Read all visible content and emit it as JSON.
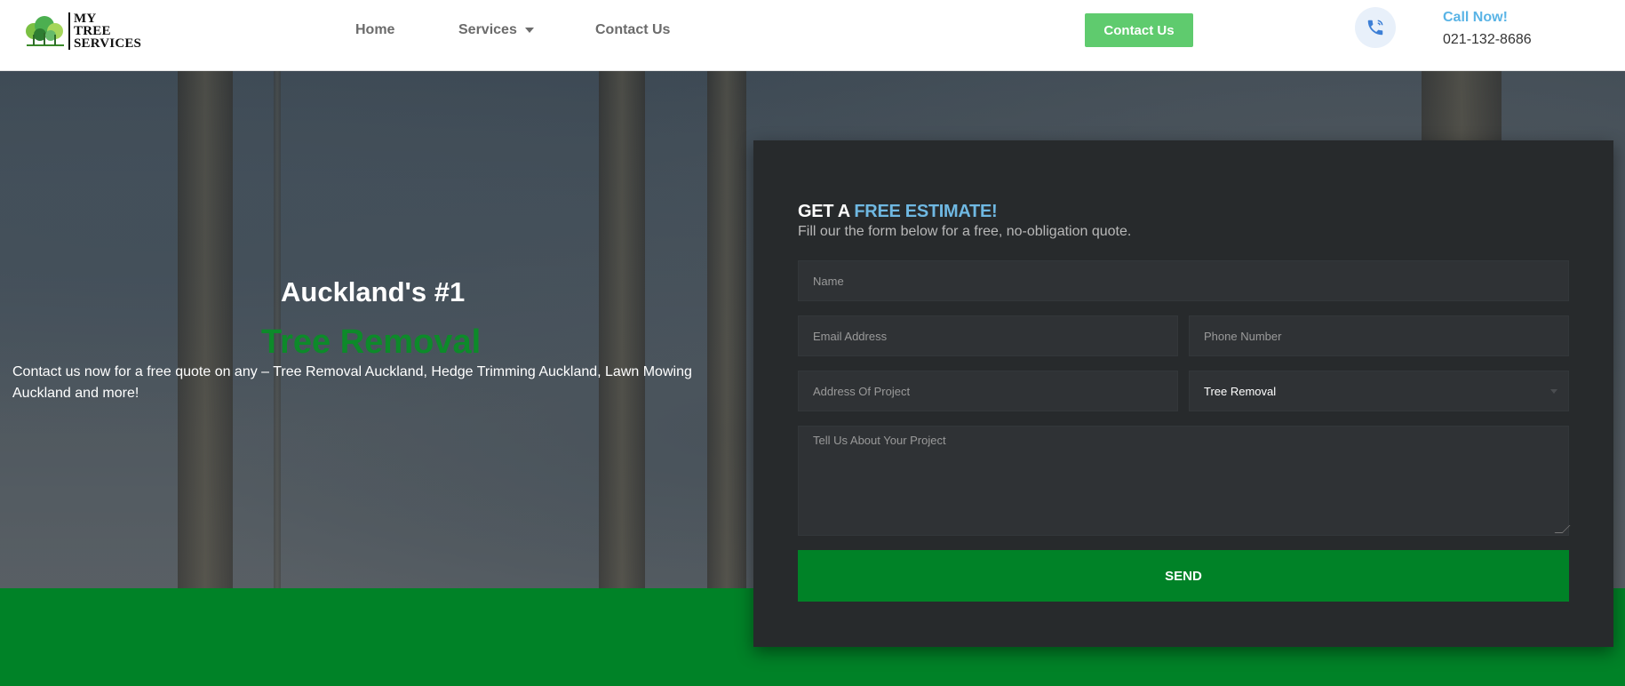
{
  "header": {
    "logo_text": [
      "MY",
      "TREE",
      "SERVICES"
    ],
    "nav": {
      "home": "Home",
      "services": "Services",
      "contact": "Contact Us"
    },
    "contact_button": "Contact Us",
    "call_label": "Call Now!",
    "phone": "021-132-8686",
    "icons": {
      "logo": "tree-logo-icon",
      "phone": "phone-icon",
      "caret": "chevron-down-icon"
    }
  },
  "hero": {
    "line1": "Auckland's #1",
    "line2": "Tree Removal",
    "description": "Contact us now for a free quote on any – Tree Removal Auckland, Hedge Trimming Auckland, Lawn Mowing Auckland and more!"
  },
  "form": {
    "title_prefix": "GET A ",
    "title_accent": "FREE ESTIMATE!",
    "subtitle": "Fill our the form below for a free, no-obligation quote.",
    "placeholders": {
      "name": "Name",
      "email": "Email Address",
      "phone": "Phone Number",
      "address": "Address Of Project",
      "message": "Tell Us About Your Project"
    },
    "service_selected": "Tree Removal",
    "send_label": "SEND"
  },
  "colors": {
    "brand_green": "#008227",
    "button_green": "#5fcb6e",
    "accent_blue": "#6fb8e2",
    "form_bg": "#272a2c"
  }
}
